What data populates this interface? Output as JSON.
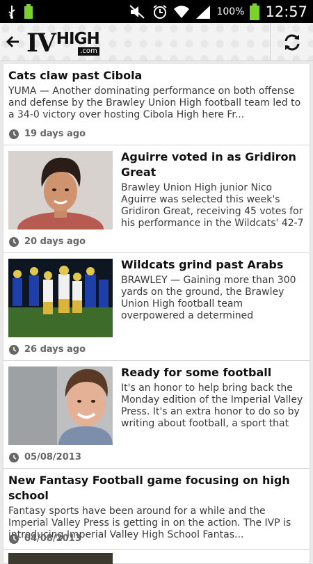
{
  "status": {
    "battery_pct": "100%",
    "time": "12:57"
  },
  "appbar": {
    "logo_iv": "IV",
    "logo_high": "HIGH",
    "logo_com": ".com"
  },
  "articles": [
    {
      "title": "Cats claw past Cibola",
      "excerpt": "YUMA — Another dominating performance on both offense and defense by the Brawley Union High football team led to a 34-0 victory over hosting Cibola High here Fr...",
      "date": "19 days ago"
    },
    {
      "title": "Aguirre voted in as Gridiron Great",
      "excerpt": "Brawley Union High junior Nico Aguirre was selected this week's Gridiron Great, receiving 45 votes for his performance in the Wildcats' 42-7",
      "date": "20 days ago"
    },
    {
      "title": "Wildcats grind past Arabs",
      "excerpt": "BRAWLEY — Gaining more than 300 yards on the ground, the Brawley Union High football team overpowered a determined Coachella Valley High,",
      "date": "26 days ago"
    },
    {
      "title": "Ready for some football",
      "excerpt": "It's an honor to help bring back the Monday edition of the Imperial Valley Press. It's an extra honor to do so by writing about football, a sport that has",
      "date": "05/08/2013"
    },
    {
      "title": "New Fantasy Football game focusing on high school",
      "excerpt": "Fantasy sports have been around for a while and the Imperial Valley Press is getting in on the action. The IVP is introducing Imperial Valley High School Fantas...",
      "date": "04/08/2013"
    }
  ]
}
